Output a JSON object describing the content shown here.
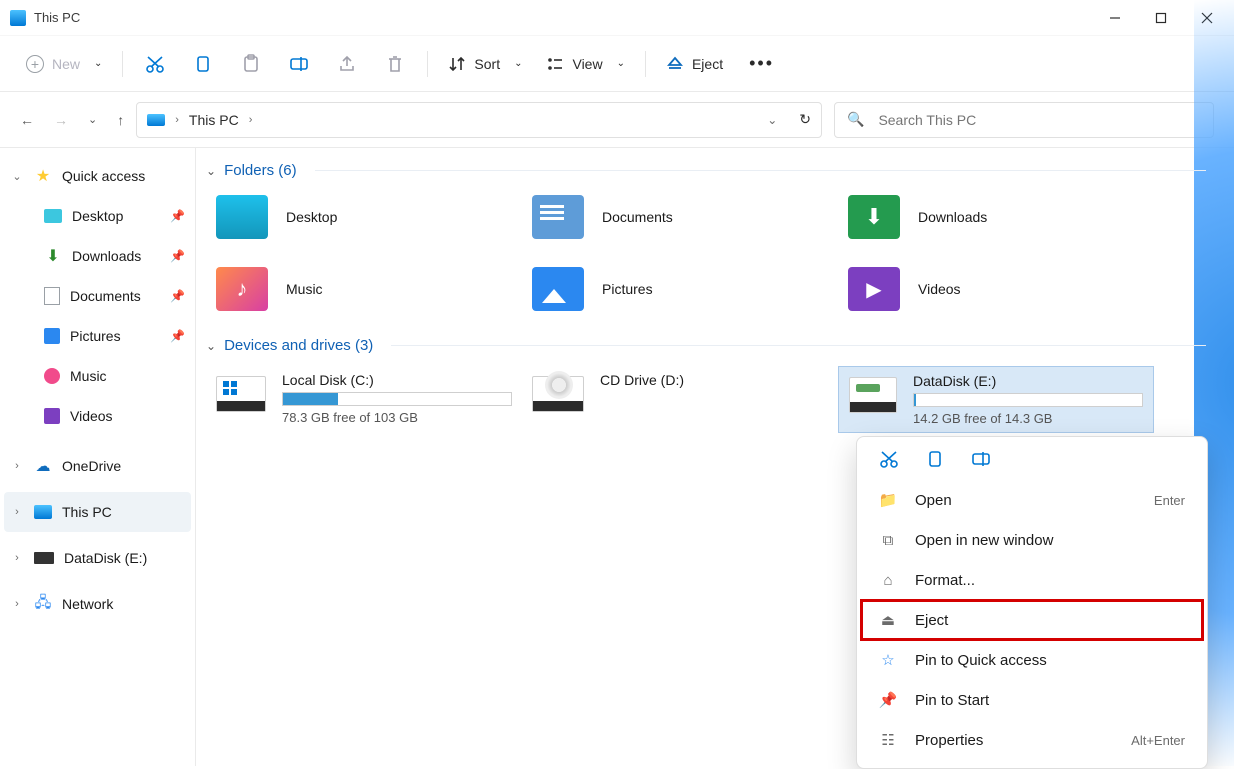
{
  "titlebar": {
    "title": "This PC"
  },
  "toolbar": {
    "new_label": "New",
    "sort_label": "Sort",
    "view_label": "View",
    "eject_label": "Eject"
  },
  "breadcrumb": {
    "location": "This PC"
  },
  "search": {
    "placeholder": "Search This PC"
  },
  "sidebar": {
    "quick_access": "Quick access",
    "items": [
      {
        "label": "Desktop",
        "pinned": true
      },
      {
        "label": "Downloads",
        "pinned": true
      },
      {
        "label": "Documents",
        "pinned": true
      },
      {
        "label": "Pictures",
        "pinned": true
      },
      {
        "label": "Music",
        "pinned": false
      },
      {
        "label": "Videos",
        "pinned": false
      }
    ],
    "onedrive": "OneDrive",
    "this_pc": "This PC",
    "datadisk": "DataDisk (E:)",
    "network": "Network"
  },
  "content": {
    "folders_header": "Folders (6)",
    "folders": [
      {
        "name": "Desktop"
      },
      {
        "name": "Documents"
      },
      {
        "name": "Downloads"
      },
      {
        "name": "Music"
      },
      {
        "name": "Pictures"
      },
      {
        "name": "Videos"
      }
    ],
    "drives_header": "Devices and drives (3)",
    "drives": [
      {
        "name": "Local Disk (C:)",
        "free_text": "78.3 GB free of 103 GB",
        "used_pct": 24
      },
      {
        "name": "CD Drive (D:)"
      },
      {
        "name": "DataDisk (E:)",
        "free_text": "14.2 GB free of 14.3 GB",
        "used_pct": 1,
        "selected": true
      }
    ]
  },
  "context_menu": {
    "items": [
      {
        "label": "Open",
        "shortcut": "Enter",
        "icon": "folder"
      },
      {
        "label": "Open in new window",
        "icon": "external"
      },
      {
        "label": "Format...",
        "icon": "drive"
      },
      {
        "label": "Eject",
        "icon": "eject",
        "highlight": true
      },
      {
        "label": "Pin to Quick access",
        "icon": "star"
      },
      {
        "label": "Pin to Start",
        "icon": "pin"
      },
      {
        "label": "Properties",
        "shortcut": "Alt+Enter",
        "icon": "sliders"
      }
    ]
  }
}
